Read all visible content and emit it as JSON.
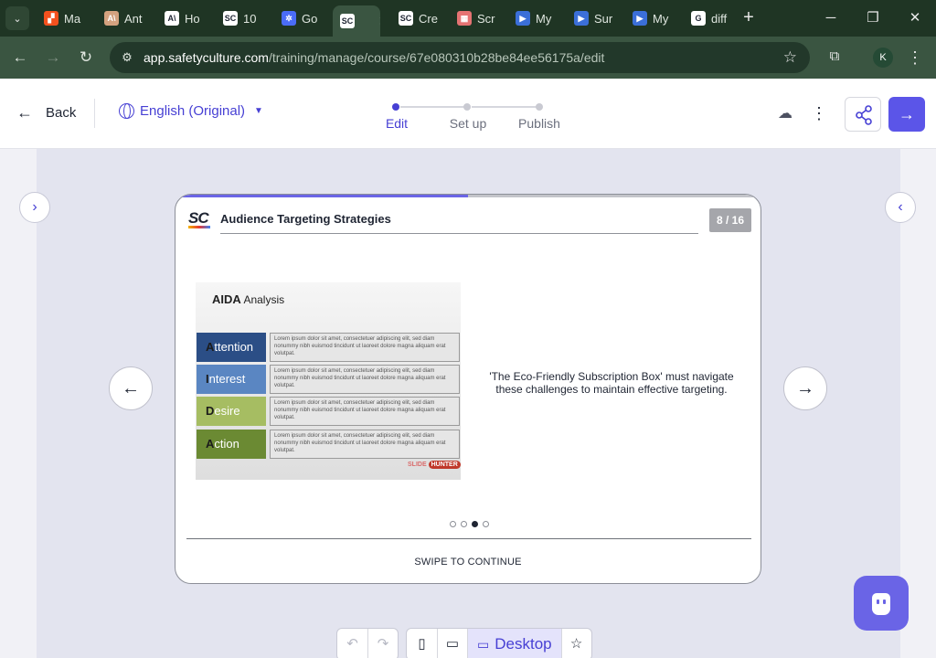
{
  "browser": {
    "tabs": [
      {
        "title": "Ma",
        "fav_color": "#f4511e",
        "fav_glyph": "▞"
      },
      {
        "title": "Ant",
        "fav_color": "#d4a27f",
        "fav_glyph": "A\\"
      },
      {
        "title": "Ho",
        "fav_color": "#ffffff",
        "fav_glyph": "A\\"
      },
      {
        "title": "10",
        "fav_color": "#ffffff",
        "fav_glyph": "SC"
      },
      {
        "title": "Go",
        "fav_color": "#4a6cf7",
        "fav_glyph": "✲"
      },
      {
        "title": "",
        "fav_color": "#ffffff",
        "fav_glyph": "SC"
      },
      {
        "title": "Cre",
        "fav_color": "#ffffff",
        "fav_glyph": "SC"
      },
      {
        "title": "Scr",
        "fav_color": "#e57373",
        "fav_glyph": "▦"
      },
      {
        "title": "My",
        "fav_color": "#3b6fd8",
        "fav_glyph": "▶"
      },
      {
        "title": "Sur",
        "fav_color": "#3b6fd8",
        "fav_glyph": "▶"
      },
      {
        "title": "My",
        "fav_color": "#3b6fd8",
        "fav_glyph": "▶"
      },
      {
        "title": "diff",
        "fav_color": "#ffffff",
        "fav_glyph": "G"
      }
    ],
    "url_host": "app.safetyculture.com",
    "url_path": "/training/manage/course/67e080310b28be84ee56175a/edit",
    "profile_initial": "K"
  },
  "header": {
    "back_label": "Back",
    "language": "English (Original)",
    "steps": [
      {
        "label": "Edit",
        "active": true
      },
      {
        "label": "Set up",
        "active": false
      },
      {
        "label": "Publish",
        "active": false
      }
    ]
  },
  "slide": {
    "title": "Audience Targeting Strategies",
    "logo_text": "SC",
    "counter": "8 / 16",
    "progress_fraction": 0.5,
    "image": {
      "heading_bold": "AIDA",
      "heading_rest": " Analysis",
      "rows": [
        {
          "first": "A",
          "rest": "ttention",
          "color": "#2b4e86",
          "text": "Lorem ipsum dolor sit amet, consectetuer adipiscing elit, sed diam nonummy nibh euismod tincidunt ut laoreet dolore magna aliquam erat volutpat."
        },
        {
          "first": "I",
          "rest": "nterest",
          "color": "#5a86c2",
          "text": "Lorem ipsum dolor sit amet, consectetuer adipiscing elit, sed diam nonummy nibh euismod tincidunt ut laoreet dolore magna aliquam erat volutpat."
        },
        {
          "first": "D",
          "rest": "esire",
          "color": "#a6bd62",
          "text": "Lorem ipsum dolor sit amet, consectetuer adipiscing elit, sed diam nonummy nibh euismod tincidunt ut laoreet dolore magna aliquam erat volutpat."
        },
        {
          "first": "A",
          "rest": "ction",
          "color": "#6b8a33",
          "text": "Lorem ipsum dolor sit amet, consectetuer adipiscing elit, sed diam nonummy nibh euismod tincidunt ut laoreet dolore magna aliquam erat volutpat."
        }
      ],
      "brand_left": "SLIDE",
      "brand_right": "HUNTER"
    },
    "quote": "'The Eco-Friendly Subscription Box' must navigate these challenges to maintain effective targeting.",
    "page_dots": 4,
    "active_dot": 2,
    "swipe_label": "SWIPE TO CONTINUE"
  },
  "devices": {
    "desktop_label": "Desktop"
  },
  "colors": {
    "accent": "#4740d4",
    "browser_bg": "#1f3524"
  }
}
